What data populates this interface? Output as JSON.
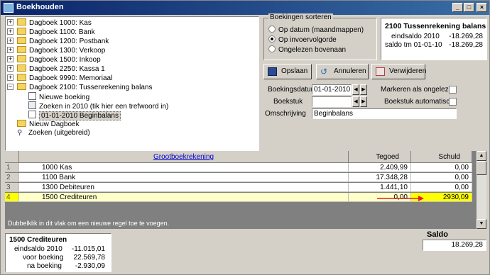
{
  "window": {
    "title": "Boekhouden"
  },
  "tree": {
    "items": [
      {
        "label": "Dagboek 1000: Kas",
        "type": "folder",
        "expander": "+"
      },
      {
        "label": "Dagboek 1100: Bank",
        "type": "folder",
        "expander": "+"
      },
      {
        "label": "Dagboek 1200: Postbank",
        "type": "folder",
        "expander": "+"
      },
      {
        "label": "Dagboek 1300: Verkoop",
        "type": "folder",
        "expander": "+"
      },
      {
        "label": "Dagboek 1500: Inkoop",
        "type": "folder",
        "expander": "+"
      },
      {
        "label": "Dagboek 2250: Kassa 1",
        "type": "folder",
        "expander": "+"
      },
      {
        "label": "Dagboek 9990: Memoriaal",
        "type": "folder",
        "expander": "+"
      },
      {
        "label": "Dagboek 2100: Tussenrekening balans",
        "type": "folder",
        "expander": "-"
      },
      {
        "label": "Nieuwe boeking",
        "type": "doc"
      },
      {
        "label": "Zoeken in 2010 (tik hier een trefwoord in)",
        "type": "doc"
      },
      {
        "label": "01-01-2010 Beginbalans",
        "type": "doc",
        "selected": true
      },
      {
        "label": "Nieuw Dagboek",
        "type": "folder"
      },
      {
        "label": "Zoeken (uitgebreid)",
        "type": "search"
      }
    ]
  },
  "sort": {
    "legend": "Boekingen sorteren",
    "options": [
      {
        "label": "Op datum (maandmappen)",
        "checked": false
      },
      {
        "label": "Op invoervolgorde",
        "checked": true
      },
      {
        "label": "Ongelezen bovenaan",
        "checked": false
      }
    ]
  },
  "balance": {
    "title": "2100 Tussenrekening balans",
    "rows": [
      {
        "label": "eindsaldo 2010",
        "value": "-18.269,28"
      },
      {
        "label": "saldo tm 01-01-10",
        "value": "-18.269,28"
      }
    ]
  },
  "toolbar": {
    "save": "Opslaan",
    "cancel": "Annuleren",
    "delete": "Verwijderen"
  },
  "form": {
    "date_label": "Boekingsdatum",
    "date_value": "01-01-2010",
    "doc_label": "Boekstuk",
    "doc_value": "",
    "desc_label": "Omschrijving",
    "desc_value": "Beginbalans",
    "mark_unread_label": "Markeren als ongelezen",
    "auto_doc_label": "Boekstuk automatisch"
  },
  "grid": {
    "columns": [
      "Grootboekrekening",
      "Tegoed",
      "Schuld"
    ],
    "rows": [
      {
        "n": "1",
        "account": "1000 Kas",
        "credit": "2.409,99",
        "debit": "0,00"
      },
      {
        "n": "2",
        "account": "1100 Bank",
        "credit": "17.348,28",
        "debit": "0,00"
      },
      {
        "n": "3",
        "account": "1300 Debiteuren",
        "credit": "1.441,10",
        "debit": "0,00"
      },
      {
        "n": "4",
        "account": "1500 Crediteuren",
        "credit": "0,00",
        "debit": "2930,09"
      }
    ],
    "hint": "Dubbelklik in dit vlak om een nieuwe regel toe te voegen."
  },
  "info": {
    "title": "1500 Crediteuren",
    "rows": [
      {
        "label": "eindsaldo 2010",
        "value": "-11.015,01"
      },
      {
        "label": "voor boeking",
        "value": "22.569,78"
      },
      {
        "label": "na boeking",
        "value": "-2.930,09"
      }
    ]
  },
  "saldo": {
    "label": "Saldo",
    "value": "18.269,28"
  },
  "colors": {
    "title_bar": "#0a246a",
    "highlight_row": "#ffffc8",
    "edit_cell": "#ffff00",
    "arrow": "#e02020"
  }
}
